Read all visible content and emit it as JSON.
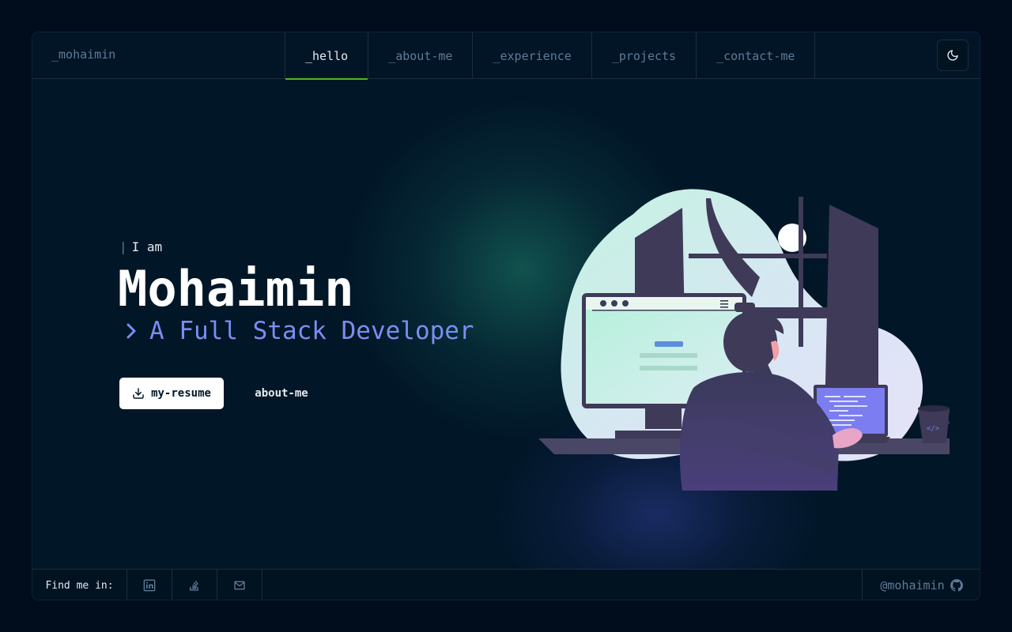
{
  "header": {
    "brand": "_mohaimin",
    "nav": [
      {
        "label": "_hello",
        "active": true
      },
      {
        "label": "_about-me",
        "active": false
      },
      {
        "label": "_experience",
        "active": false
      },
      {
        "label": "_projects",
        "active": false
      },
      {
        "label": "_contact-me",
        "active": false
      }
    ],
    "theme_icon": "moon-icon"
  },
  "hero": {
    "intro": "I am",
    "name": "Mohaimin",
    "role": "A Full Stack Developer",
    "resume_button": "my-resume",
    "about_button": "about-me"
  },
  "footer": {
    "find_label": "Find me in:",
    "socials": [
      "linkedin-icon",
      "stackoverflow-icon",
      "mail-icon"
    ],
    "github_handle": "@mohaimin"
  },
  "colors": {
    "background": "#011627",
    "accent_green": "#4fb51f",
    "accent_blue": "#7b8ef0",
    "muted": "#607b96"
  }
}
